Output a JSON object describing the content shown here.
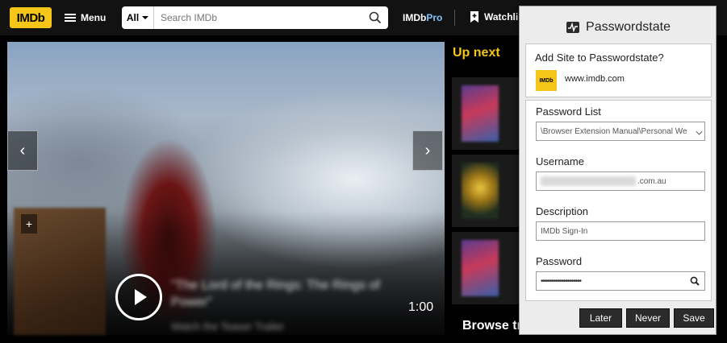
{
  "imdb": {
    "logo_text": "IMDb",
    "menu_label": "Menu",
    "search_category": "All",
    "search_placeholder": "Search IMDb",
    "imdbpro_label_a": "IMDb",
    "imdbpro_label_b": "Pro",
    "watchlist_label": "Watchlis",
    "brand_color": "#f5c518"
  },
  "hero": {
    "trailer_title": "\"The Lord of the Rings: The Rings of Power\"",
    "trailer_subtitle": "Watch the Teaser Trailer",
    "duration": "1:00",
    "prev_arrow": "‹",
    "next_arrow": "›"
  },
  "upnext": {
    "title": "Up next",
    "browse_label": "Browse tr"
  },
  "passwordstate": {
    "title": "Passwordstate",
    "add_prompt": "Add Site to Passwordstate?",
    "site_logo_text": "IMDb",
    "site_url": "www.imdb.com",
    "password_list_label": "Password List",
    "password_list_value": "\\Browser Extension Manual\\Personal We",
    "username_label": "Username",
    "username_suffix": ".com.au",
    "description_label": "Description",
    "description_value": "IMDb Sign-In",
    "password_label": "Password",
    "password_mask": "••••••••••••••••••••",
    "later_label": "Later",
    "never_label": "Never",
    "save_label": "Save"
  }
}
